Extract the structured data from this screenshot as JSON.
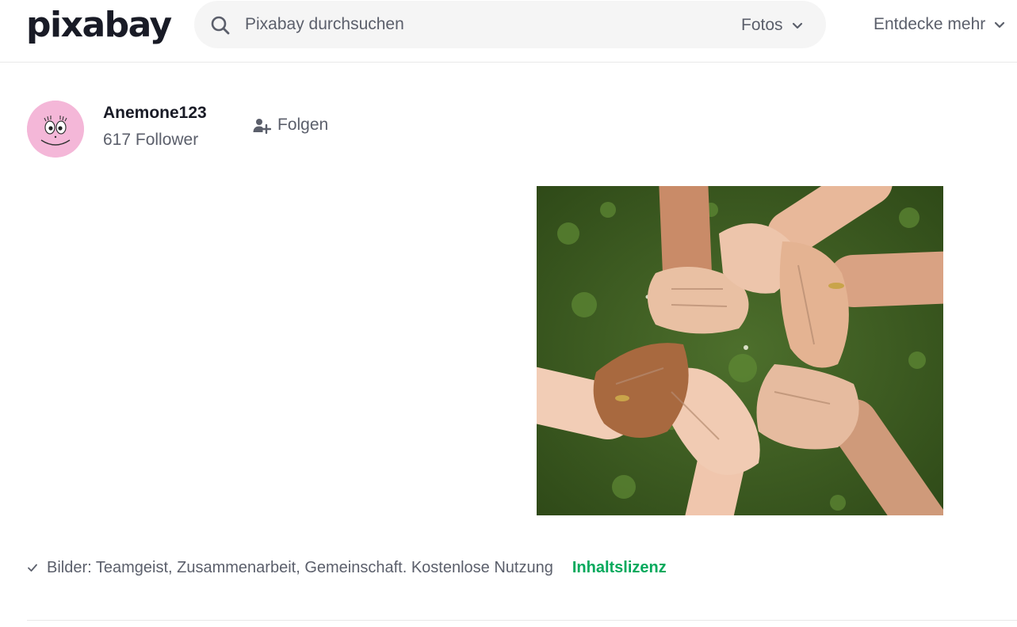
{
  "header": {
    "logo_text": "pixabay",
    "search": {
      "placeholder": "Pixabay durchsuchen",
      "value": "",
      "icon": "search-icon"
    },
    "media_type": {
      "selected": "Fotos",
      "icon": "chevron-down-icon"
    },
    "explore_label": "Entdecke mehr"
  },
  "profile": {
    "username": "Anemone123",
    "followers": "617 Follower",
    "follow_label": "Folgen",
    "follow_icon": "user-plus-icon"
  },
  "image": {
    "subject": "hands-linked-in-circle-photo",
    "background_color": "#3d5a22"
  },
  "caption": {
    "icon": "checkmark-icon",
    "text": "Bilder: Teamgeist, Zusammenarbeit, Gemeinschaft. Kostenlose Nutzung",
    "license_label": "Inhaltslizenz",
    "license_color": "#02a95c"
  }
}
